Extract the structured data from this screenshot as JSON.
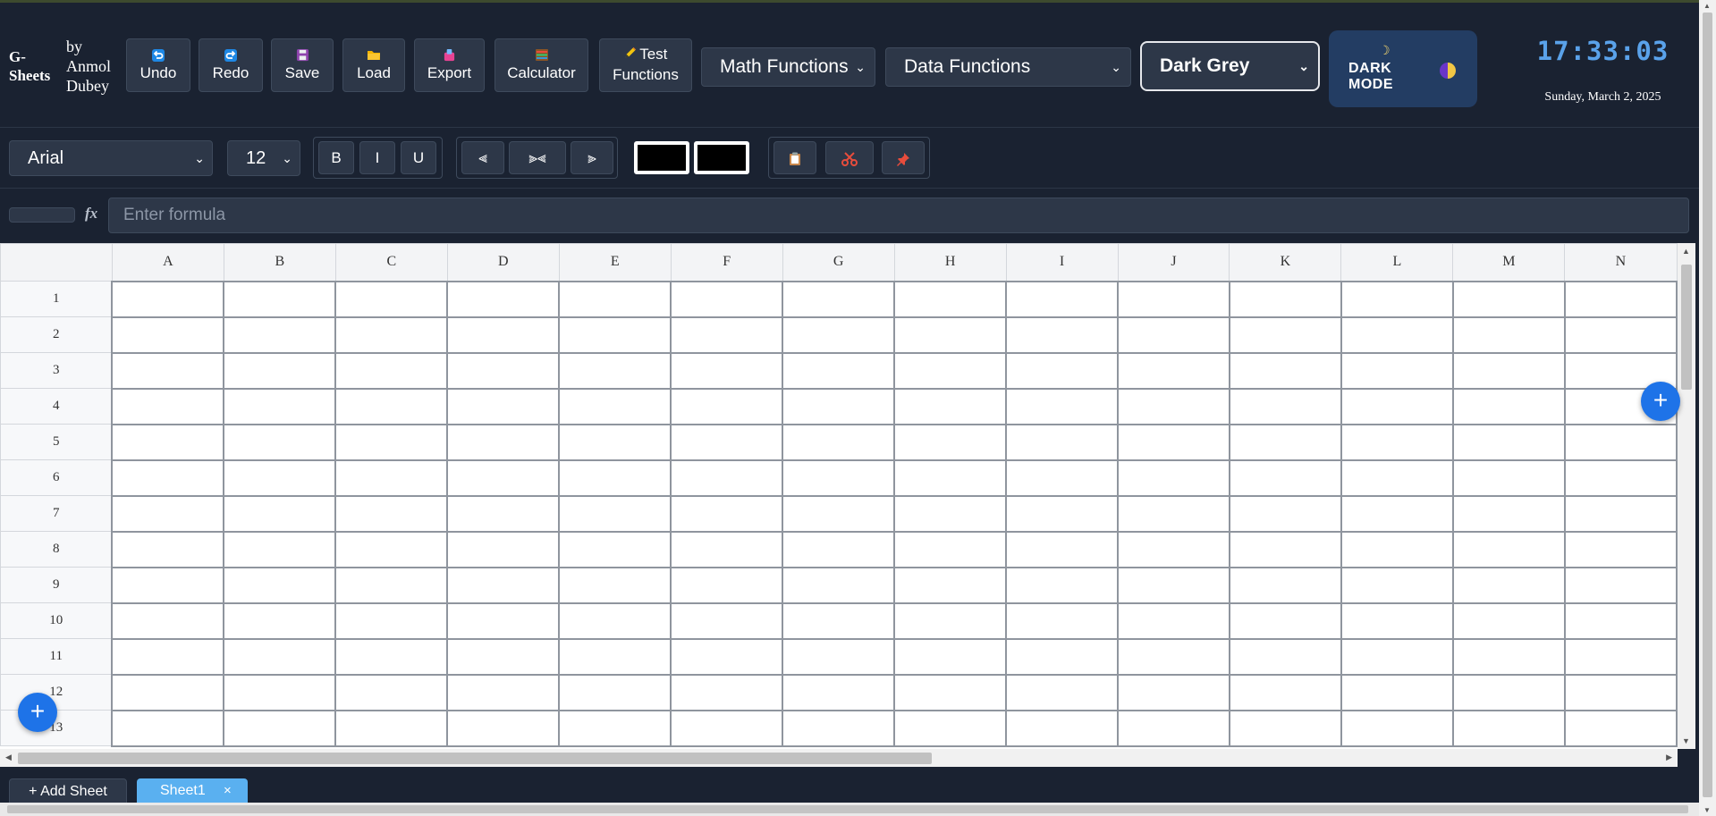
{
  "brand": {
    "logo_line1": "G-",
    "logo_line2": "Sheets",
    "by_line1": "by",
    "by_line2": "Anmol",
    "by_line3": "Dubey"
  },
  "toolbar": {
    "undo": {
      "icon": "undo-icon",
      "label": "Undo"
    },
    "redo": {
      "icon": "redo-icon",
      "label": "Redo"
    },
    "save": {
      "icon": "floppy-disk-icon",
      "label": "Save"
    },
    "load": {
      "icon": "folder-icon",
      "label": "Load"
    },
    "export": {
      "icon": "export-icon",
      "label": "Export"
    },
    "calculator": {
      "icon": "abacus-icon",
      "label": "Calculator"
    },
    "test_functions": {
      "icon": "pencil-icon",
      "label_line1": "Test",
      "label_line2": "Functions"
    },
    "math_functions": "Math Functions",
    "data_functions": "Data Functions",
    "theme": "Dark Grey",
    "dark_mode": {
      "line1": "DARK",
      "line2": "MODE",
      "icon": "moon-icon"
    }
  },
  "clock": {
    "time": "17:33:03",
    "date": "Sunday, March 2, 2025"
  },
  "format_bar": {
    "font_family": "Arial",
    "font_size": "12",
    "bold": "B",
    "italic": "I",
    "underline": "U",
    "align_left": "⫷",
    "align_center": "⫸⫷",
    "align_right": "⫸",
    "text_color": "#000000",
    "fill_color": "#000000",
    "copy_icon": "clipboard-icon",
    "cut_icon": "scissors-icon",
    "paste_icon": "pushpin-icon"
  },
  "formula_bar": {
    "fx": "fx",
    "placeholder": "Enter formula",
    "value": ""
  },
  "grid": {
    "columns": [
      "A",
      "B",
      "C",
      "D",
      "E",
      "F",
      "G",
      "H",
      "I",
      "J",
      "K",
      "L",
      "M",
      "N"
    ],
    "rows": [
      "1",
      "2",
      "3",
      "4",
      "5",
      "6",
      "7",
      "8",
      "9",
      "10",
      "11",
      "12",
      "13"
    ]
  },
  "fab_add": "+",
  "sheets": {
    "add_label": "+ Add Sheet",
    "tabs": [
      {
        "name": "Sheet1",
        "close": "×"
      }
    ]
  },
  "colors": {
    "background": "#1a2231",
    "button": "#2d3748",
    "accent": "#1e73e8",
    "clock": "#5aa2ea",
    "active_tab": "#5ab0f0",
    "dark_mode_button": "#233d63"
  }
}
